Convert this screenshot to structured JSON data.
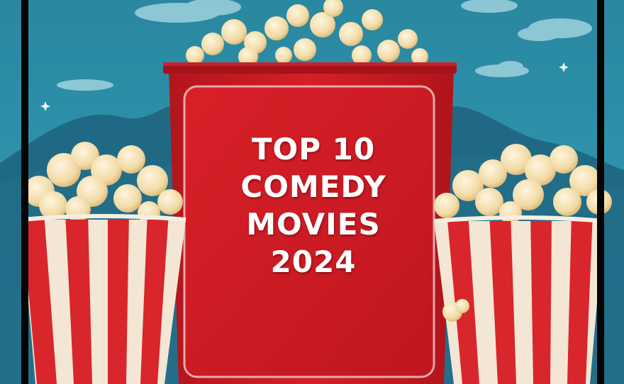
{
  "poster": {
    "title_lines": [
      "TOP 10",
      "COMEDY",
      "MOVIES",
      "2024"
    ]
  },
  "colors": {
    "sky": "#2c8ea6",
    "mountains": "#1d5a74",
    "box_red": "#c81a22",
    "stripe_red": "#d8262c",
    "stripe_cream": "#f3e6d4",
    "popcorn": "#f4dfb0",
    "frame": "#050505",
    "text": "#ffffff"
  },
  "icons": [
    "popcorn-box-icon",
    "popcorn-bucket-icon",
    "sparkle-icon",
    "cloud-icon"
  ]
}
